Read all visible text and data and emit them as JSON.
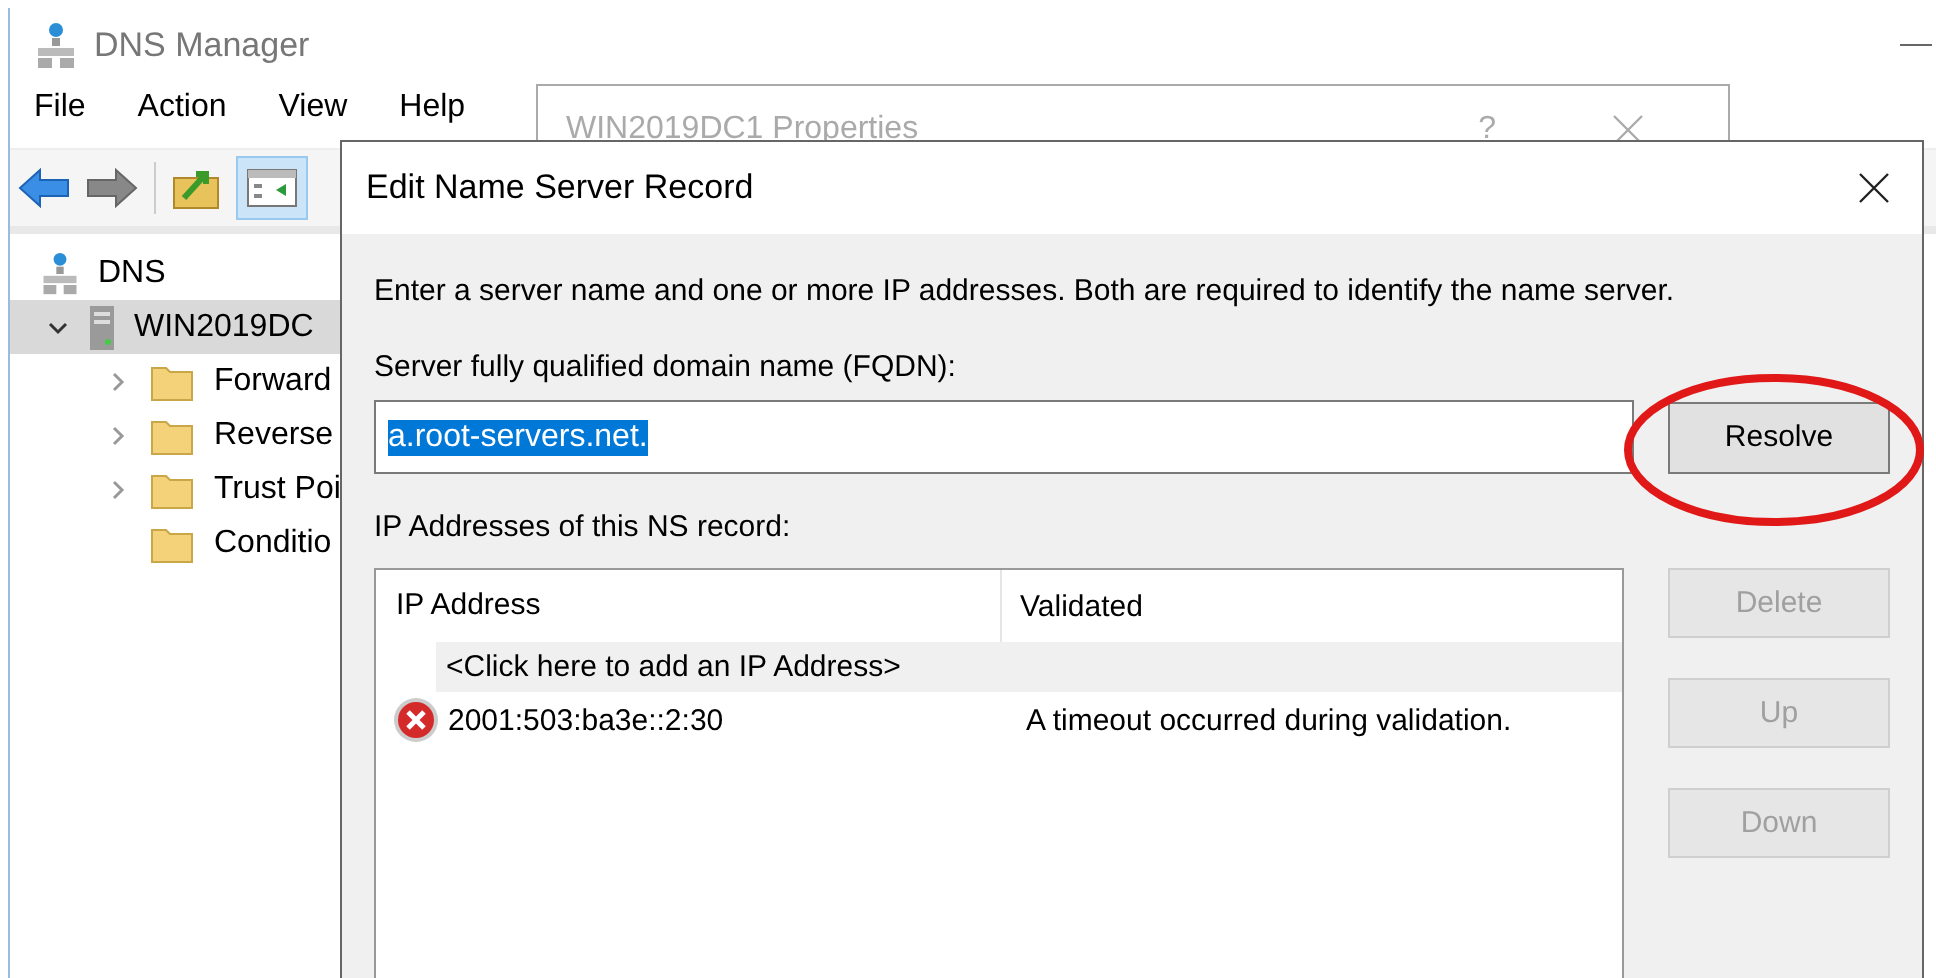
{
  "main_window": {
    "title": "DNS Manager",
    "menu": [
      "File",
      "Action",
      "View",
      "Help"
    ],
    "tree": [
      {
        "label": "DNS",
        "children": [
          {
            "label": "WIN2019DC",
            "selected": true,
            "expanded": true,
            "children": [
              {
                "label": "Forward",
                "expandable": true
              },
              {
                "label": "Reverse",
                "expandable": true
              },
              {
                "label": "Trust Poi",
                "expandable": true
              },
              {
                "label": "Conditio",
                "expandable": false
              }
            ]
          }
        ]
      }
    ]
  },
  "properties_dialog": {
    "title": "WIN2019DC1 Properties",
    "help": "?"
  },
  "dialog": {
    "title": "Edit Name Server Record",
    "intro": "Enter a server name and one or more IP addresses.  Both are required to identify the name server.",
    "fqdn_label": "Server fully qualified domain name (FQDN):",
    "fqdn": {
      "value": "a.root-servers.net.",
      "selected": true
    },
    "resolve": "Resolve",
    "ip_label": "IP Addresses of this NS record:",
    "columns": [
      "IP Address",
      "Validated"
    ],
    "add_row": "<Click here to add an IP Address>",
    "rows": [
      {
        "address": "2001:503:ba3e::2:30",
        "validated": "A timeout occurred during validation.",
        "kind": "error"
      }
    ],
    "side_buttons": [
      {
        "label": "Delete",
        "disabled": true
      },
      {
        "label": "Up",
        "disabled": true
      },
      {
        "label": "Down",
        "disabled": true
      }
    ]
  }
}
